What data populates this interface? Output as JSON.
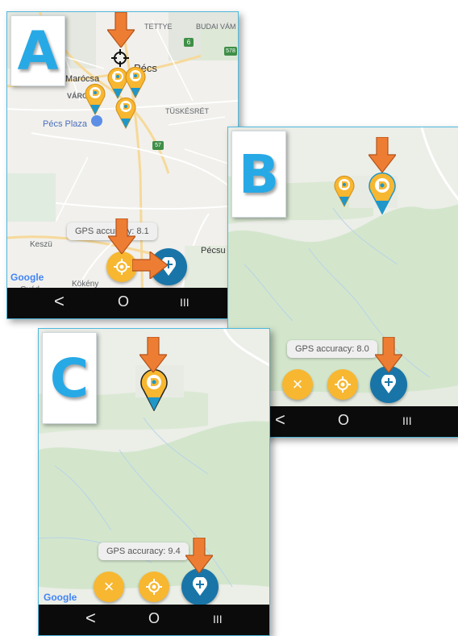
{
  "colors": {
    "accent_orange": "#f7b731",
    "fab_blue": "#1975a8",
    "arrow_orange": "#ee7d34",
    "panel_border": "#4fb8dd",
    "letter_blue": "#27a9e6",
    "map_green": "#d3e6cc",
    "map_land": "#e9ebe6"
  },
  "panelA": {
    "letter": "A",
    "places": {
      "tettye": "TETTYE",
      "budai_vam": "BUDAI VÁM",
      "road_6": "6",
      "road_578": "578",
      "marocsa": "Marócsa",
      "varos": "VÁROS",
      "tuskesret": "TÜSKÉSRÉT",
      "pecs_plaza": "Pécs Plaza",
      "road_57": "57",
      "keszu": "Keszü",
      "pecsu": "Pécsu",
      "kokeny": "Kökény",
      "gyod": "Gyód",
      "pecs": "Pécs"
    },
    "gps": "GPS accuracy: 8.1",
    "google": "Google"
  },
  "panelB": {
    "letter": "B",
    "gps": "GPS accuracy: 8.0"
  },
  "panelC": {
    "letter": "C",
    "gps": "GPS accuracy: 9.4",
    "google": "Google"
  },
  "icons": {
    "cancel": "close-icon",
    "locate": "locate-icon",
    "add_pin": "add-location-icon",
    "crosshair": "crosshair-icon",
    "nav_back": "nav-back-icon",
    "nav_home": "nav-home-icon",
    "nav_recents": "nav-recents-icon"
  },
  "nav": {
    "back": "<",
    "home": "O",
    "recents": "III"
  },
  "fab": {
    "cancel": "×"
  }
}
